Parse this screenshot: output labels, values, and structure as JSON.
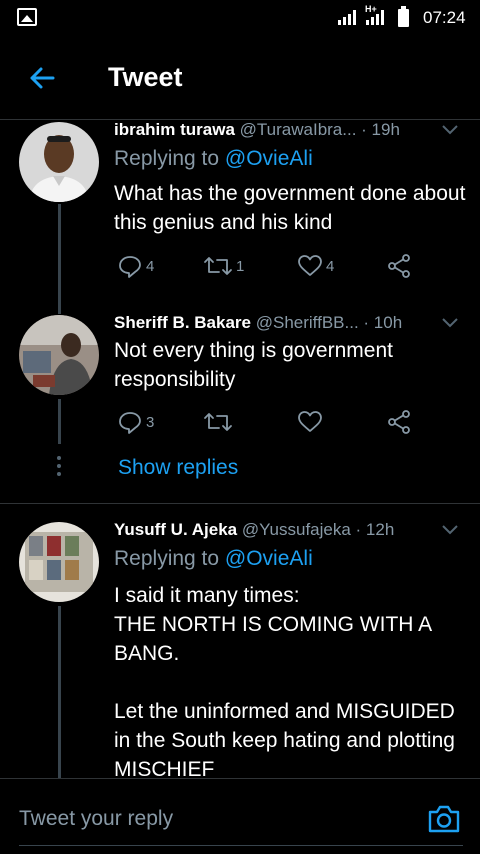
{
  "status_bar": {
    "network_type": "H+",
    "time": "07:24"
  },
  "header": {
    "title": "Tweet",
    "back_icon": "arrow-left-icon"
  },
  "colors": {
    "accent": "#1da1f2",
    "secondary_text": "#8899a6",
    "background": "#000000",
    "divider": "#2f3336"
  },
  "tweets": [
    {
      "name": "ibrahim turawa",
      "handle": "@TurawaIbra...",
      "time": "· 19h",
      "replying_label": "Replying to ",
      "replying_to": "@OvieAli",
      "text": "What has the government done about this genius and his kind",
      "replies": "4",
      "retweets": "1",
      "likes": "4"
    },
    {
      "name": "Sheriff B. Bakare",
      "handle": "@SheriffBB...",
      "time": "· 10h",
      "text": "Not every thing is government responsibility",
      "replies": "3",
      "retweets": "",
      "likes": ""
    },
    {
      "name": "Yusuff U. Ajeka",
      "handle": "@Yussufajeka",
      "time": "· 12h",
      "replying_label": "Replying to ",
      "replying_to": "@OvieAli",
      "text": "I said it many times:\nTHE NORTH IS COMING WITH A BANG.\n\nLet the uninformed and MISGUIDED in the South keep hating and plotting MISCHIEF"
    }
  ],
  "show_replies_label": "Show replies",
  "reply_bar": {
    "placeholder": "Tweet your reply",
    "camera_icon": "camera-icon"
  }
}
